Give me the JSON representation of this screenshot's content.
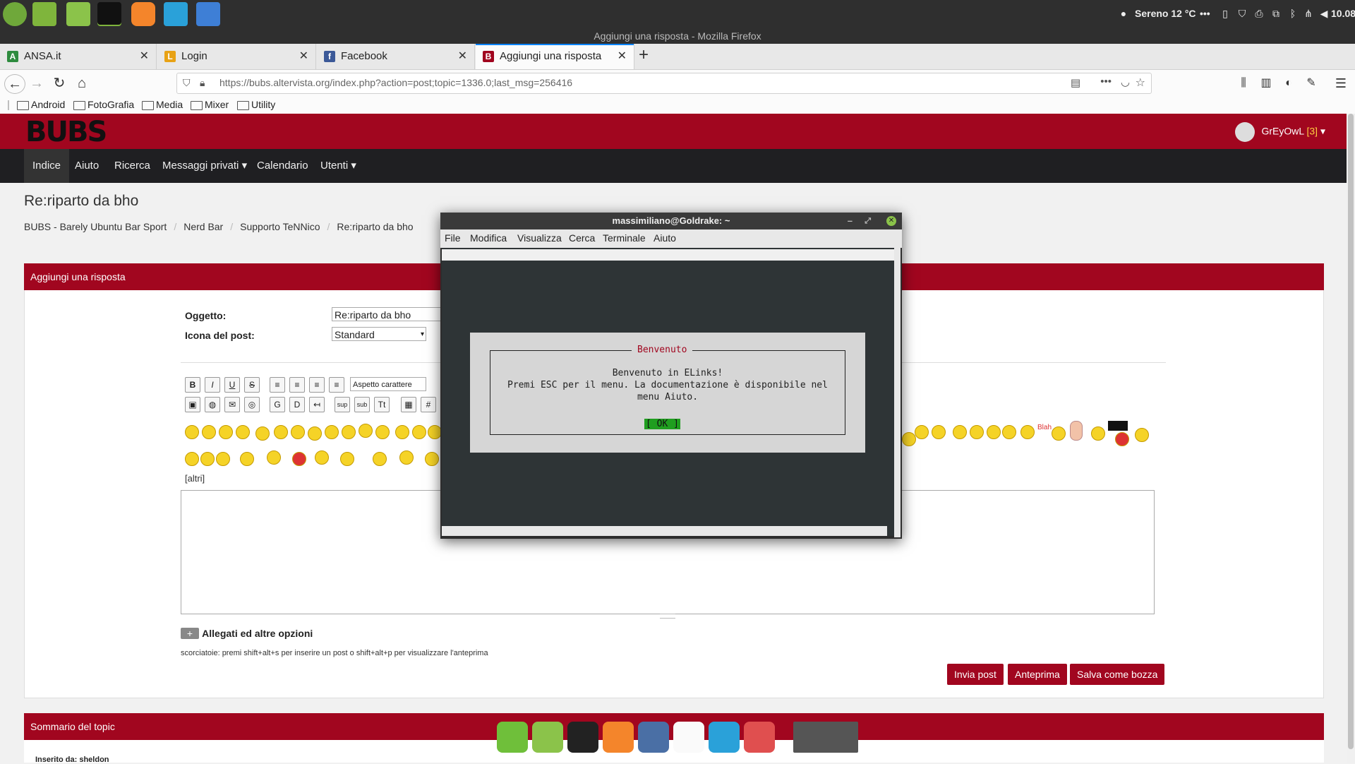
{
  "panel": {
    "weather": "Sereno 12 °C",
    "more": "•••",
    "clock": "10.08"
  },
  "window": {
    "title": "Aggiungi una risposta - Mozilla Firefox"
  },
  "tabs": [
    {
      "label": "ANSA.it",
      "favicon": "A",
      "color": "#2e8b3e"
    },
    {
      "label": "Login",
      "favicon": "L",
      "color": "#e8a215"
    },
    {
      "label": "Facebook",
      "favicon": "f",
      "color": "#3b5998"
    },
    {
      "label": "Aggiungi una risposta",
      "favicon": "B",
      "color": "#a1061f"
    }
  ],
  "new_tab": "+",
  "url": "https://bubs.altervista.org/index.php?action=post;topic=1336.0;last_msg=256416",
  "bookmarks": [
    "Android",
    "FotoGrafia",
    "Media",
    "Mixer",
    "Utility"
  ],
  "site": {
    "logo": "BUBS",
    "user": "GrEyOwL",
    "user_count": "[3]",
    "nav": [
      "Indice",
      "Aiuto",
      "Ricerca",
      "Messaggi privati",
      "Calendario",
      "Utenti"
    ],
    "page_title": "Re:riparto da bho",
    "breadcrumb": [
      "BUBS - Barely Ubuntu Bar Sport",
      "Nerd Bar",
      "Supporto TeNNico",
      "Re:riparto da bho"
    ]
  },
  "form": {
    "header": "Aggiungi una risposta",
    "subject_label": "Oggetto:",
    "subject_value": "Re:riparto da bho",
    "icon_label": "Icona del post:",
    "icon_value": "Standard",
    "font_select": "Aspetto carattere",
    "more_smileys": "[altri]",
    "attachments": "Allegati ed altre opzioni",
    "shortcuts": "scorciatoie: premi shift+alt+s per inserire un post o shift+alt+p per visualizzare l'anteprima",
    "btn_post": "Invia post",
    "btn_preview": "Anteprima",
    "btn_draft": "Salva come bozza",
    "blah": "Blah"
  },
  "summary": {
    "header": "Sommario del topic",
    "first_line": "Inserito da: sheldon"
  },
  "terminal": {
    "title": "massimiliano@Goldrake: ~",
    "menu": [
      "File",
      "Modifica",
      "Visualizza",
      "Cerca",
      "Terminale",
      "Aiuto"
    ],
    "dialog_title": "Benvenuto",
    "line1": "Benvenuto in ELinks!",
    "line2": "Premi ESC per il menu. La documentazione è disponibile nel",
    "line3": "menu Aiuto.",
    "ok": "[ OK ]"
  },
  "colors": {
    "brand": "#a1061f",
    "nav_dark": "#1f1f22",
    "mint_green": "#7fb53c"
  }
}
